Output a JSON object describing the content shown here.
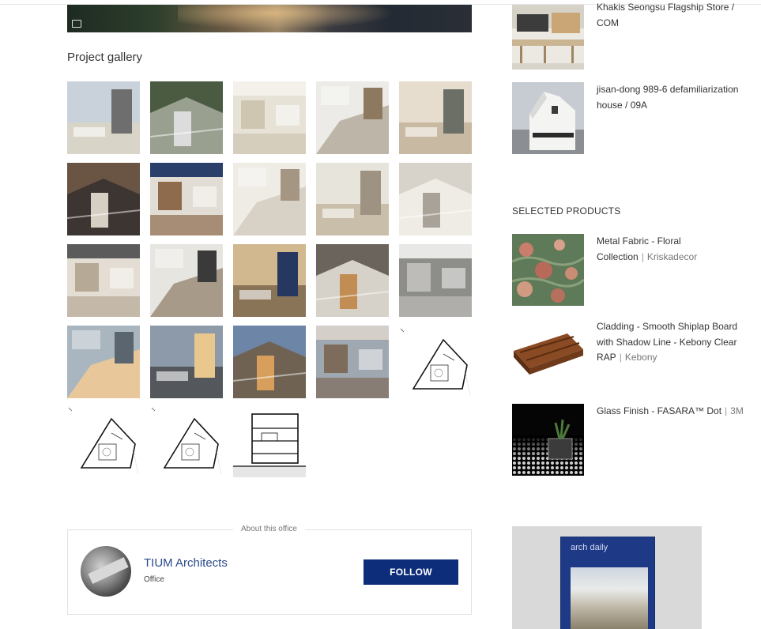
{
  "gallery": {
    "title": "Project gallery",
    "images": [
      {
        "name": "gallery-image-1",
        "kind": "photo",
        "colors": [
          "#c9d2da",
          "#d8d4c8",
          "#6e6e6e"
        ]
      },
      {
        "name": "gallery-image-2",
        "kind": "photo",
        "colors": [
          "#4a5b42",
          "#9aa08f",
          "#dcdcdc"
        ]
      },
      {
        "name": "gallery-image-3",
        "kind": "photo",
        "colors": [
          "#e7e2d6",
          "#cfc6b2",
          "#f3f1ea"
        ]
      },
      {
        "name": "gallery-image-4",
        "kind": "photo",
        "colors": [
          "#ecebe7",
          "#bdb6a8",
          "#8c7960"
        ]
      },
      {
        "name": "gallery-image-5",
        "kind": "photo",
        "colors": [
          "#e6ddcf",
          "#c7b9a2",
          "#6b6f66"
        ]
      },
      {
        "name": "gallery-image-6",
        "kind": "photo",
        "colors": [
          "#6a5443",
          "#3d3532",
          "#d6cfc4"
        ]
      },
      {
        "name": "gallery-image-7",
        "kind": "photo",
        "colors": [
          "#e2ddd4",
          "#8f6b4d",
          "#2a3f6a"
        ]
      },
      {
        "name": "gallery-image-8",
        "kind": "photo",
        "colors": [
          "#efece6",
          "#d8d1c6",
          "#a59684"
        ]
      },
      {
        "name": "gallery-image-9",
        "kind": "photo",
        "colors": [
          "#e7e4dc",
          "#c9bea9",
          "#9e9382"
        ]
      },
      {
        "name": "gallery-image-10",
        "kind": "photo",
        "colors": [
          "#d8d3ca",
          "#efece5",
          "#a8a298"
        ]
      },
      {
        "name": "gallery-image-11",
        "kind": "photo",
        "colors": [
          "#e3ddd3",
          "#b6aa97",
          "#5b5b5b"
        ]
      },
      {
        "name": "gallery-image-12",
        "kind": "photo",
        "colors": [
          "#e7e5e0",
          "#a89a89",
          "#3a3a3a"
        ]
      },
      {
        "name": "gallery-image-13",
        "kind": "photo",
        "colors": [
          "#d2b88e",
          "#8a7458",
          "#263860"
        ]
      },
      {
        "name": "gallery-image-14",
        "kind": "photo",
        "colors": [
          "#6b645c",
          "#d6d1c9",
          "#c28d52"
        ]
      },
      {
        "name": "gallery-image-15",
        "kind": "photo",
        "colors": [
          "#8d8d8a",
          "#bdbcb8",
          "#e8e8e6"
        ]
      },
      {
        "name": "gallery-image-16",
        "kind": "photo",
        "colors": [
          "#a9b5bf",
          "#e8c79a",
          "#5b6570"
        ]
      },
      {
        "name": "gallery-image-17",
        "kind": "photo",
        "colors": [
          "#8c9aa9",
          "#54585c",
          "#e9c88e"
        ]
      },
      {
        "name": "gallery-image-18",
        "kind": "photo",
        "colors": [
          "#6d86a8",
          "#6f6253",
          "#d89f5c"
        ]
      },
      {
        "name": "gallery-image-19",
        "kind": "photo",
        "colors": [
          "#9fa7b0",
          "#7d6b5b",
          "#d4cfc8"
        ]
      },
      {
        "name": "gallery-image-20",
        "kind": "plan"
      },
      {
        "name": "gallery-image-21",
        "kind": "plan"
      },
      {
        "name": "gallery-image-22",
        "kind": "plan"
      },
      {
        "name": "gallery-image-23",
        "kind": "section"
      }
    ]
  },
  "sidebar": {
    "related": [
      {
        "title": "Khakis Seongsu Flagship Store / COM",
        "colors": [
          "#e9e6df",
          "#c8b89a",
          "#3b3b3b"
        ]
      },
      {
        "title": "jisan-dong 989-6 defamiliarization house / 09A",
        "colors": [
          "#c9ced4",
          "#f3f3f3",
          "#3a3a3a"
        ]
      }
    ],
    "products_heading": "SELECTED PRODUCTS",
    "products": [
      {
        "name": "Metal Fabric - Floral Collection",
        "brand": "Kriskadecor",
        "separator": "|"
      },
      {
        "name": "Cladding - Smooth Shiplap Board with Shadow Line - Kebony Clear RAP",
        "brand": "Kebony",
        "separator": "|"
      },
      {
        "name": "Glass Finish - FASARA™ Dot",
        "brand": "3M",
        "separator": "|"
      }
    ]
  },
  "about": {
    "legend": "About this office",
    "office_name": "TIUM Architects",
    "office_type": "Office",
    "follow_label": "FOLLOW"
  },
  "ad": {
    "magazine_logo": "arch daily"
  },
  "colors": {
    "accent": "#0d2d7a",
    "office_link": "#2a4a8c",
    "brand_text": "#777777"
  }
}
